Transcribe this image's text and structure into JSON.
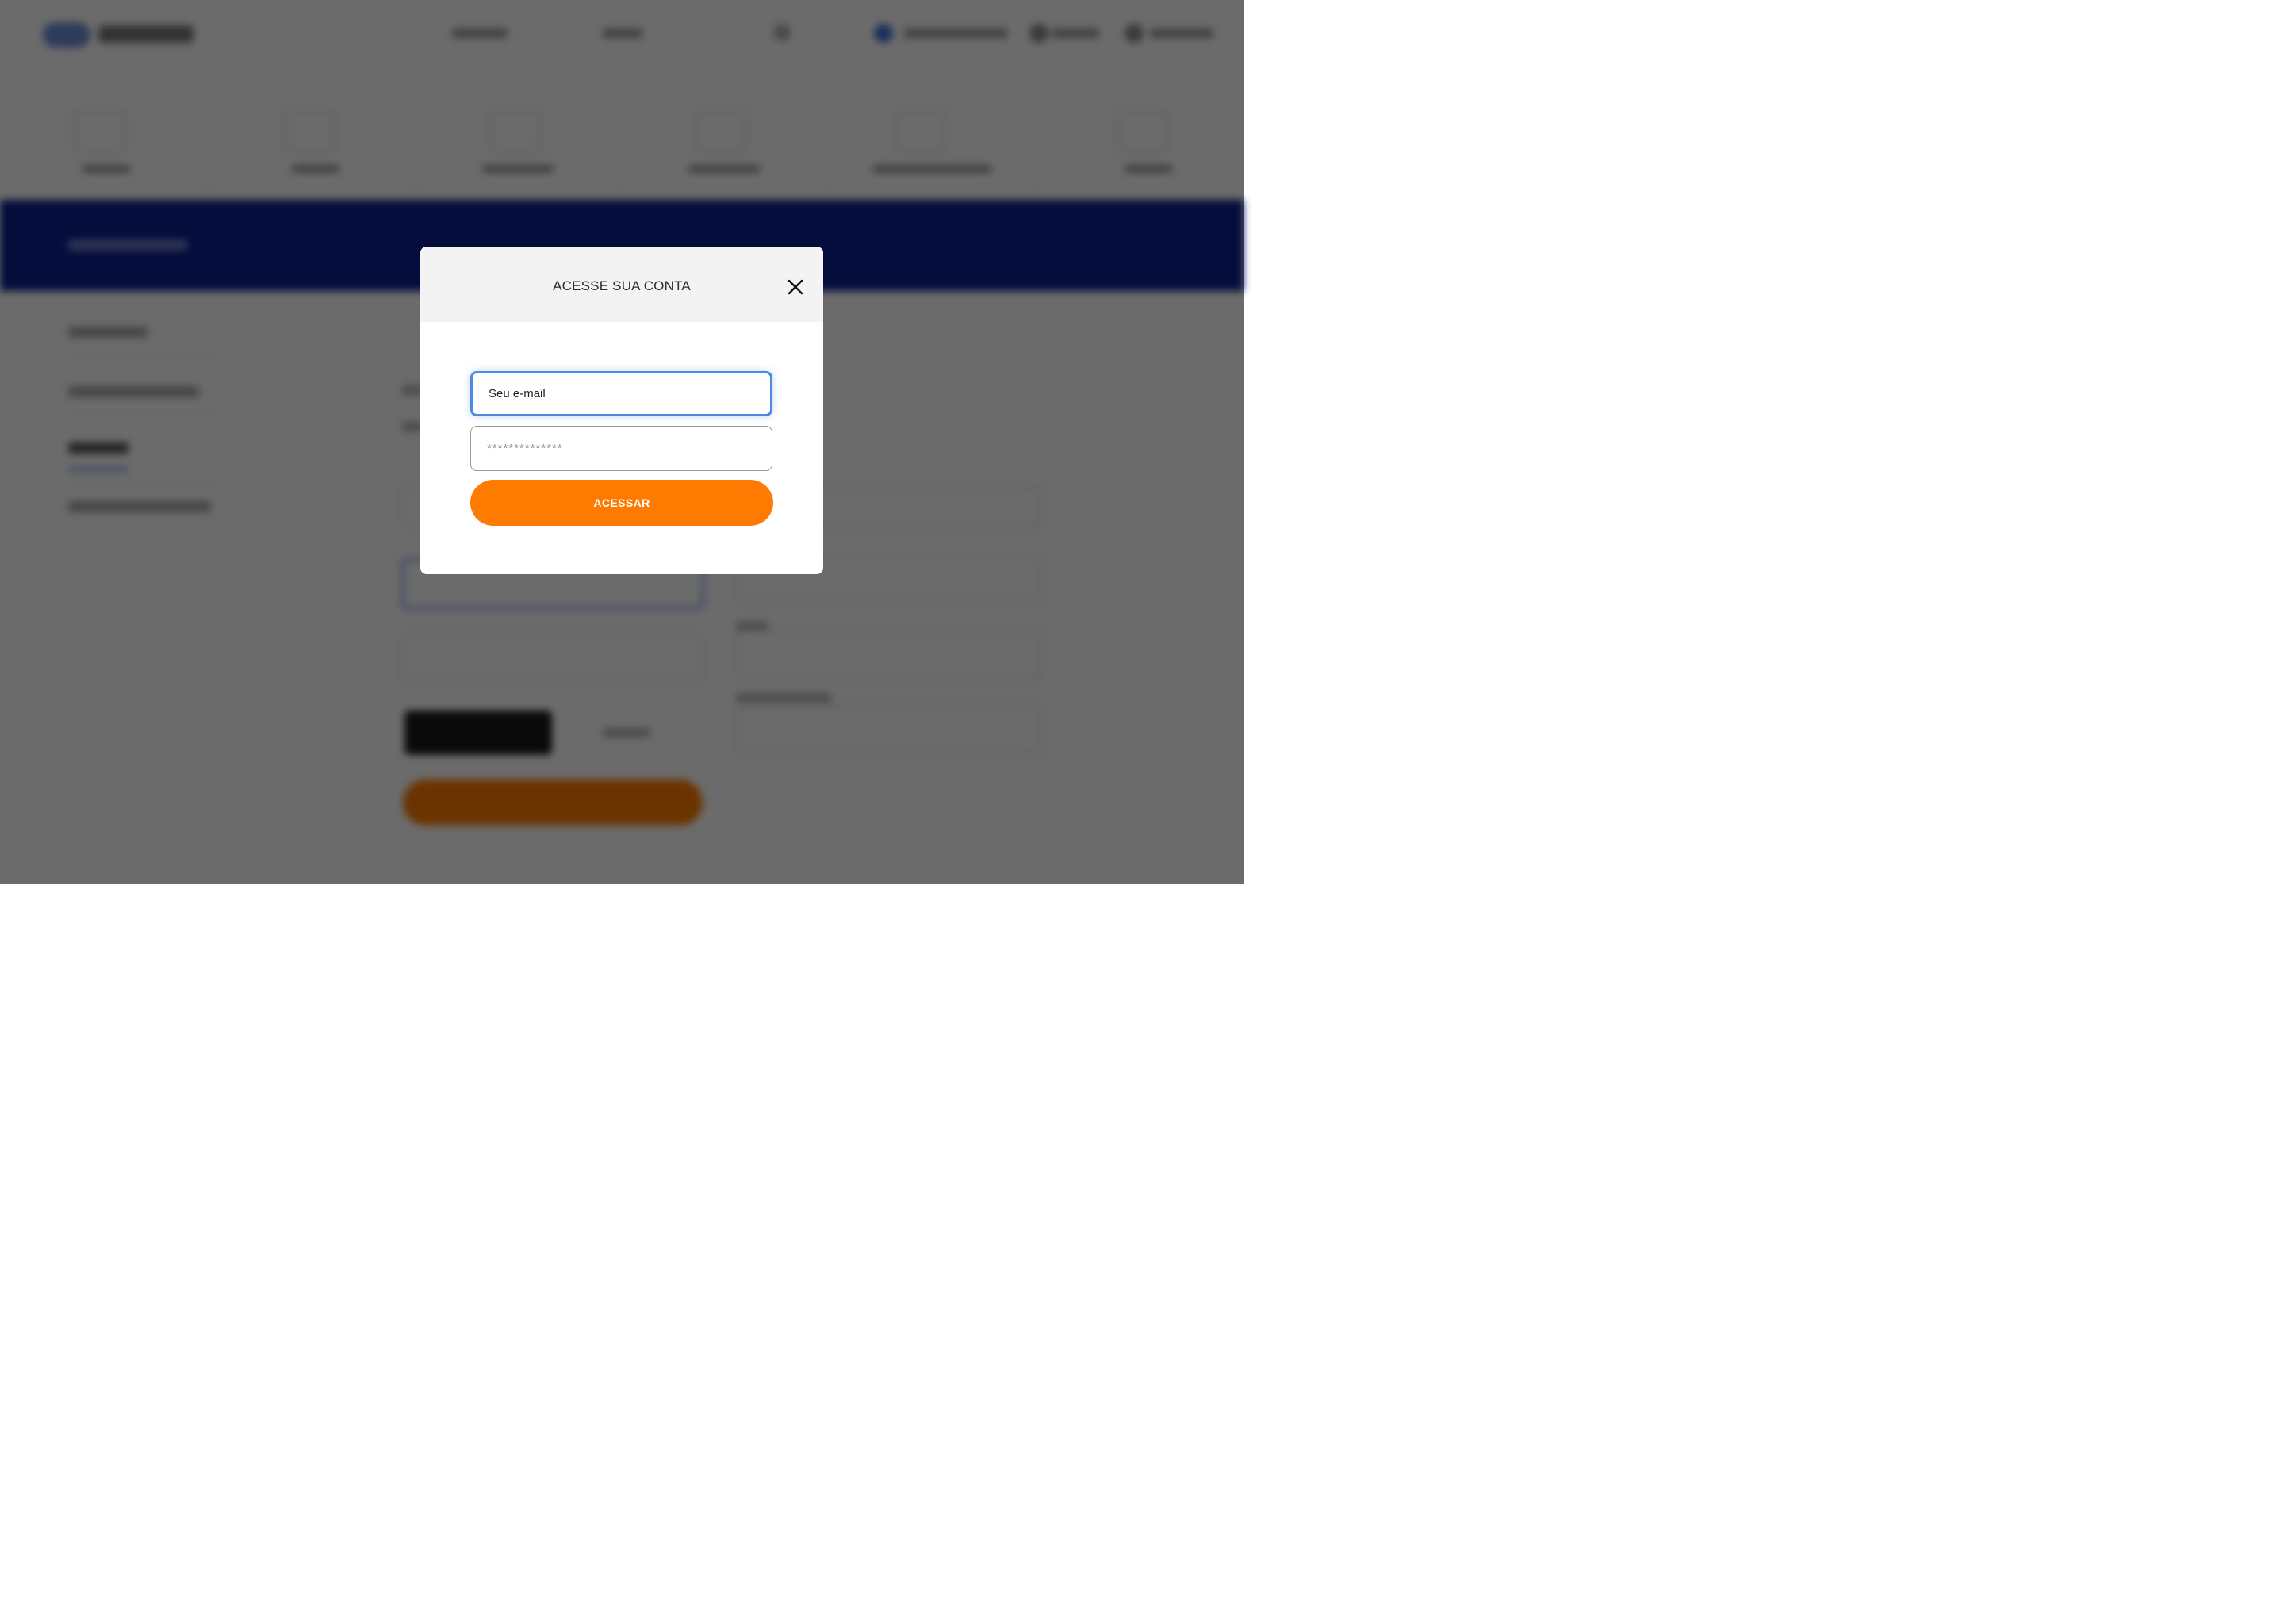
{
  "modal": {
    "title": "ACESSE SUA CONTA",
    "email_placeholder": "Seu e-mail",
    "email_value": "",
    "password_placeholder": "**************",
    "password_value": "",
    "submit_label": "ACESSAR",
    "close_icon": "close-icon"
  },
  "colors": {
    "accent_orange": "#ff7a00",
    "focus_blue": "#4a8ae2",
    "header_bg": "#f3f3f4",
    "banner_blue": "#0a1f8f",
    "overlay": "rgba(0,0,0,0.58)"
  }
}
